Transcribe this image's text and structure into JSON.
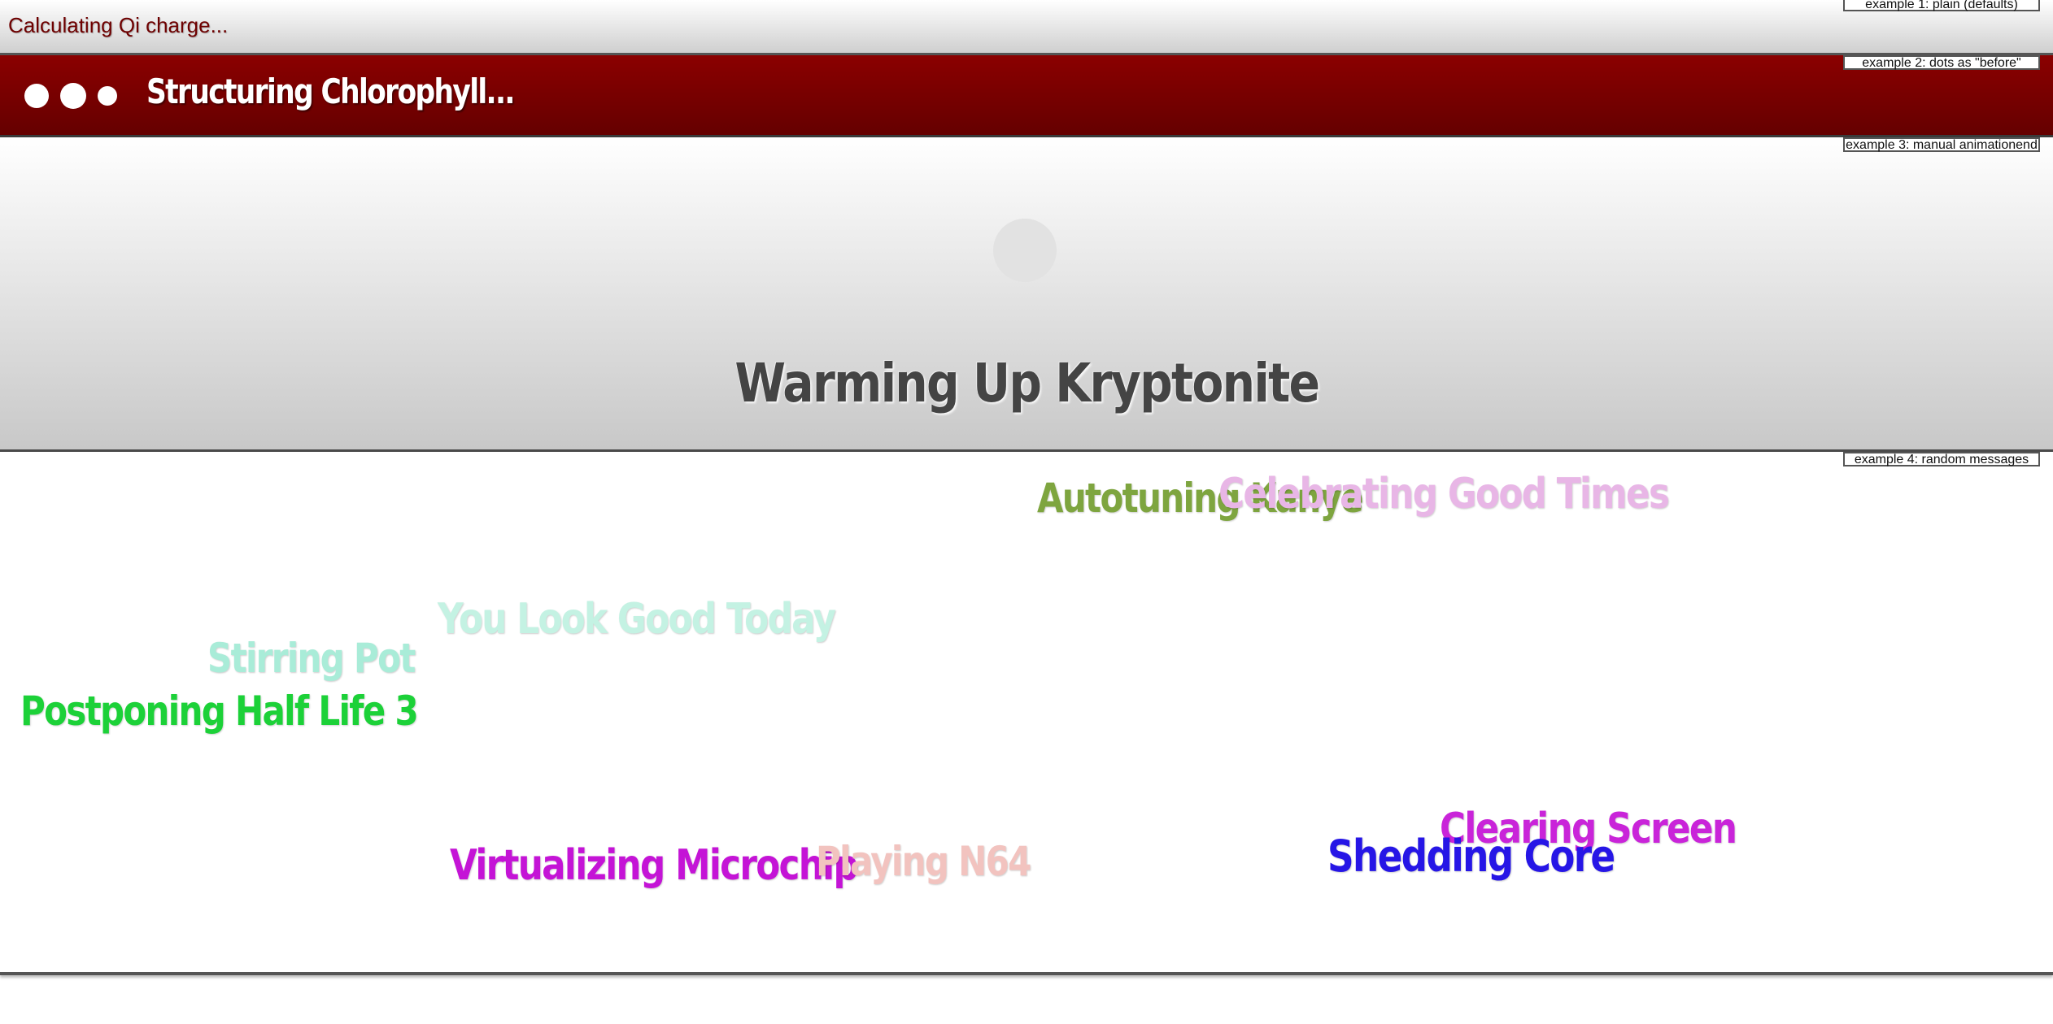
{
  "examples": {
    "ex1": {
      "label": "example 1: plain (defaults)",
      "message": "Calculating Qi charge...",
      "message_color": "#6e0000"
    },
    "ex2": {
      "label": "example 2: dots as \"before\"",
      "message": "Structuring Chlorophyll...",
      "background": "#7a0000",
      "dots": 3
    },
    "ex3": {
      "label": "example 3: manual animationend",
      "message": "Warming Up Kryptonite"
    },
    "ex4": {
      "label": "example 4: random messages",
      "messages": [
        {
          "text": "Autotuning Kanye",
          "color": "#7ea53f"
        },
        {
          "text": "Celebrating Good Times",
          "color": "#e8b6e6"
        },
        {
          "text": "You Look Good Today",
          "color": "#c4f2e3"
        },
        {
          "text": "Stirring Pot",
          "color": "#a9ecd8"
        },
        {
          "text": "Postponing Half Life 3",
          "color": "#1cd138"
        },
        {
          "text": "Clearing Screen",
          "color": "#c924d9"
        },
        {
          "text": "Shedding Core",
          "color": "#2616e6"
        },
        {
          "text": "Virtualizing Microchip",
          "color": "#c414d6"
        },
        {
          "text": "Playing N64",
          "color": "#f2c3bf"
        }
      ]
    }
  }
}
